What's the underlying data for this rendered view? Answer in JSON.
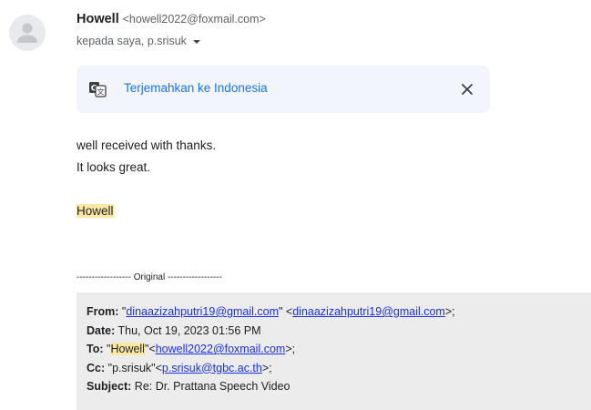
{
  "sender": {
    "name": "Howell",
    "email": "<howell2022@foxmail.com>",
    "recipients": "kepada saya, p.srisuk"
  },
  "translate": {
    "label": "Terjemahkan ke Indonesia"
  },
  "body": {
    "line1": "well received with thanks.",
    "line2": "It looks great.",
    "signature": "Howell"
  },
  "original_separator": "------------------ Original ------------------",
  "quoted": {
    "from_label": "From:",
    "from_q1": "\"",
    "from_name_email": "dinaazizahputri19@gmail.com",
    "from_q2": "\" <",
    "from_email": "dinaazizahputri19@gmail.com",
    "from_end": ">;",
    "date_label": "Date:",
    "date_value": "Thu, Oct 19, 2023 01:56 PM",
    "to_label": "To:",
    "to_q1": "\"",
    "to_name": "Howell",
    "to_q2": "\"<",
    "to_email": "howell2022@foxmail.com",
    "to_end": ">;",
    "cc_label": "Cc:",
    "cc_q1": "\"p.srisuk\"<",
    "cc_email": "p.srisuk@tgbc.ac.th",
    "cc_end": ">;",
    "subject_label": "Subject:",
    "subject_value": "Re: Dr. Prattana Speech Video"
  },
  "colors": {
    "link": "#1a73e8",
    "highlight": "#fce8a3",
    "translate_bg": "#f2f6fc",
    "quote_bg": "#ececec"
  },
  "icons": {
    "avatar": "person-icon",
    "translate": "translate-icon",
    "close": "close-icon",
    "dropdown": "caret-down-icon"
  }
}
